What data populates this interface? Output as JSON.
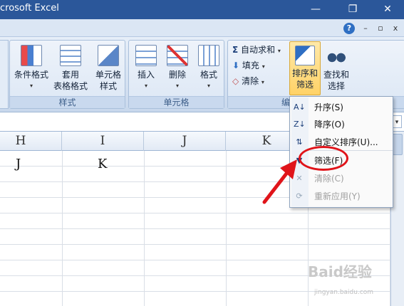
{
  "titlebar": {
    "title": "crosoft Excel",
    "minimize_glyph": "—",
    "restore_glyph": "❐",
    "close_glyph": "✕"
  },
  "subbar": {
    "help_glyph": "?",
    "min_glyph": "–",
    "restore_glyph": "▫",
    "close_glyph": "x"
  },
  "ribbon": {
    "groups": [
      {
        "label": "样式",
        "buttons": [
          {
            "line1": "条件格式",
            "line2": "",
            "icon": "conditional-format-icon"
          },
          {
            "line1": "套用",
            "line2": "表格格式",
            "icon": "table-format-icon"
          },
          {
            "line1": "单元格",
            "line2": "样式",
            "icon": "cell-style-icon"
          }
        ]
      },
      {
        "label": "单元格",
        "buttons": [
          {
            "line1": "插入",
            "icon": "insert-icon"
          },
          {
            "line1": "删除",
            "icon": "delete-icon"
          },
          {
            "line1": "格式",
            "icon": "format-icon"
          }
        ]
      },
      {
        "label": "编",
        "small": [
          {
            "label": "自动求和",
            "icon": "sigma-icon",
            "glyph": "Σ"
          },
          {
            "label": "填充",
            "icon": "fill-down-icon",
            "glyph": "⬇"
          },
          {
            "label": "清除",
            "icon": "eraser-icon",
            "glyph": "◇"
          }
        ],
        "big": [
          {
            "line1": "排序和",
            "line2": "筛选",
            "icon": "sort-filter-icon"
          },
          {
            "line1": "查找和",
            "line2": "选择",
            "icon": "binoculars-icon"
          }
        ]
      }
    ],
    "dropdown_glyph": "▾"
  },
  "columns": [
    "H",
    "I",
    "J",
    "K"
  ],
  "cells": {
    "row1": {
      "H": "J",
      "I": "K"
    }
  },
  "menu": {
    "items": [
      {
        "label": "升序(S)",
        "icon": "sort-ascending-icon",
        "glyph": "A↓",
        "disabled": false
      },
      {
        "label": "降序(O)",
        "icon": "sort-descending-icon",
        "glyph": "Z↓",
        "disabled": false
      },
      {
        "label": "自定义排序(U)...",
        "icon": "custom-sort-icon",
        "glyph": "⇅",
        "disabled": false
      },
      {
        "label": "筛选(F)",
        "icon": "filter-funnel-icon",
        "glyph": "▼",
        "disabled": false
      },
      {
        "label": "清除(C)",
        "icon": "clear-filter-icon",
        "glyph": "✕",
        "disabled": true
      },
      {
        "label": "重新应用(Y)",
        "icon": "reapply-filter-icon",
        "glyph": "⟳",
        "disabled": true
      }
    ]
  },
  "watermark": {
    "text": "Baid经验",
    "subtext": "jingyan.baidu.com"
  },
  "colors": {
    "titlebar": "#2b579a",
    "highlight": "#e0141a",
    "ribbon": "#dce7f5"
  }
}
